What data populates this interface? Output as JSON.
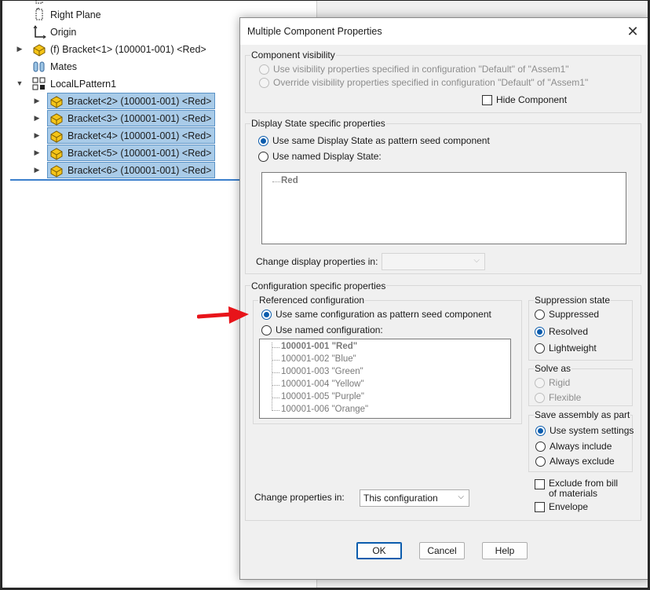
{
  "feature_tree": {
    "items": [
      {
        "label": "Right Plane",
        "icon": "plane-icon"
      },
      {
        "label": "Origin",
        "icon": "origin-icon"
      },
      {
        "label": "(f) Bracket<1> (100001-001) <Red>",
        "icon": "part-icon"
      },
      {
        "label": "Mates",
        "icon": "mates-icon"
      },
      {
        "label": "LocalLPattern1",
        "icon": "pattern-icon"
      },
      {
        "label": "Bracket<2> (100001-001) <Red>",
        "icon": "part-icon"
      },
      {
        "label": "Bracket<3> (100001-001) <Red>",
        "icon": "part-icon"
      },
      {
        "label": "Bracket<4> (100001-001) <Red>",
        "icon": "part-icon"
      },
      {
        "label": "Bracket<5> (100001-001) <Red>",
        "icon": "part-icon"
      },
      {
        "label": "Bracket<6> (100001-001) <Red>",
        "icon": "part-icon"
      }
    ]
  },
  "dialog": {
    "title": "Multiple Component Properties",
    "close_icon": "close-icon",
    "component_visibility": {
      "title": "Component visibility",
      "opt1": "Use visibility properties specified in configuration \"Default\" of \"Assem1\"",
      "opt2": "Override visibility properties specified in configuration \"Default\" of \"Assem1\"",
      "hide_component": "Hide Component"
    },
    "display_state": {
      "title": "Display State specific properties",
      "opt_same": "Use same Display State as pattern seed component",
      "opt_named": "Use named Display State:",
      "states": [
        "Red"
      ],
      "change_label": "Change display properties in:",
      "change_value": ""
    },
    "configuration": {
      "title": "Configuration specific properties",
      "referenced": {
        "title": "Referenced configuration",
        "opt_same": "Use same configuration as pattern seed component",
        "opt_named": "Use named configuration:",
        "configs": [
          "100001-001 \"Red\"",
          "100001-002 \"Blue\"",
          "100001-003 \"Green\"",
          "100001-004 \"Yellow\"",
          "100001-005 \"Purple\"",
          "100001-006 \"Orange\""
        ]
      },
      "suppression": {
        "title": "Suppression state",
        "suppressed": "Suppressed",
        "resolved": "Resolved",
        "lightweight": "Lightweight"
      },
      "solve_as": {
        "title": "Solve as",
        "rigid": "Rigid",
        "flexible": "Flexible"
      },
      "save_assembly": {
        "title": "Save assembly as part",
        "system": "Use system settings",
        "always_include": "Always include",
        "always_exclude": "Always exclude"
      },
      "exclude_bom_line1": "Exclude from bill",
      "exclude_bom_line2": "of materials",
      "envelope": "Envelope",
      "change_label": "Change properties in:",
      "change_value": "This configuration"
    },
    "buttons": {
      "ok": "OK",
      "cancel": "Cancel",
      "help": "Help"
    }
  },
  "annotation": {
    "arrow_color": "#e8141a"
  }
}
